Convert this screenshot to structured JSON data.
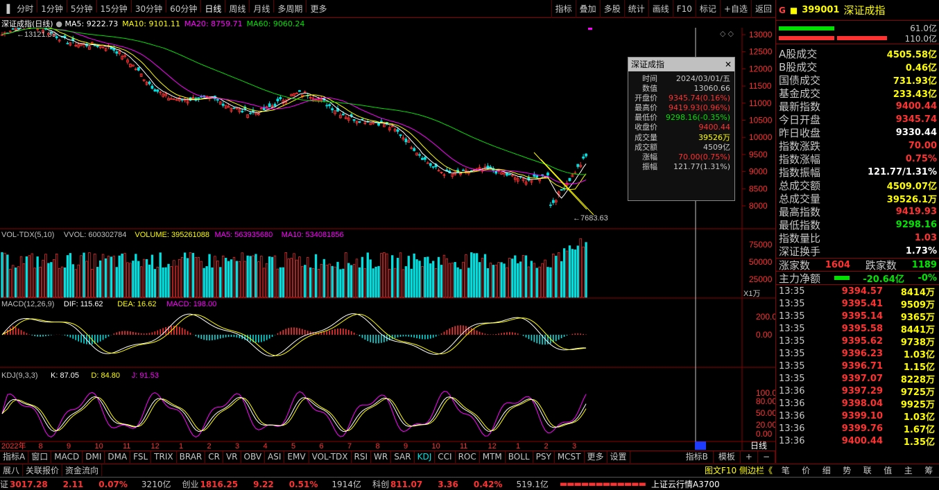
{
  "toolbar": {
    "periods": [
      "分时",
      "1分钟",
      "5分钟",
      "15分钟",
      "30分钟",
      "60分钟",
      "日线",
      "周线",
      "月线",
      "多周期",
      "更多"
    ],
    "active": "日线",
    "right": [
      "指标",
      "叠加",
      "多股",
      "统计",
      "画线",
      "F10",
      "标记",
      "+自选",
      "返回"
    ]
  },
  "chart": {
    "title": "深证成指(日线)",
    "ma": [
      {
        "t": "MA5: 9222.73",
        "c": "#ffffff"
      },
      {
        "t": "MA10: 9101.11",
        "c": "#ffff00"
      },
      {
        "t": "MA20: 8759.71",
        "c": "#ff00ff"
      },
      {
        "t": "MA60: 9060.24",
        "c": "#00e000"
      }
    ],
    "high_label": "13121.39",
    "low_label": "7683.63",
    "y_ticks": [
      "13000",
      "12500",
      "12000",
      "11500",
      "11000",
      "10500",
      "10000",
      "9500",
      "9000",
      "8500",
      "8000"
    ],
    "vol_legend": [
      {
        "t": "VOL-TDX(5,10)",
        "c": "#c0c0c0"
      },
      {
        "t": "VVOL: 600302784",
        "c": "#c0c0c0"
      },
      {
        "t": "VOLUME: 395261088",
        "c": "#ffff00"
      },
      {
        "t": "MA5: 563935680",
        "c": "#ff00ff"
      },
      {
        "t": "MA10: 534081856",
        "c": "#ff00ff"
      }
    ],
    "vol_ticks": [
      "75000",
      "50000",
      "25000"
    ],
    "vol_unit": "X1万",
    "macd_legend": [
      {
        "t": "MACD(12,26,9)",
        "c": "#c0c0c0"
      },
      {
        "t": "DIF: 115.62",
        "c": "#ffffff"
      },
      {
        "t": "DEA: 16.62",
        "c": "#ffff00"
      },
      {
        "t": "MACD: 198.00",
        "c": "#ff00ff"
      }
    ],
    "macd_ticks": [
      "200.0",
      "0.00"
    ],
    "kdj_legend": [
      {
        "t": "KDJ(9,3,3)",
        "c": "#c0c0c0"
      },
      {
        "t": "K: 87.05",
        "c": "#ffffff"
      },
      {
        "t": "D: 84.80",
        "c": "#ffff00"
      },
      {
        "t": "J: 91.53",
        "c": "#ff00ff"
      }
    ],
    "kdj_ticks": [
      "100.00",
      "80.00",
      "50.00",
      "20.00",
      "0.00"
    ],
    "x_labels": [
      "2022年",
      "8",
      "9",
      "10",
      "11",
      "12",
      "1",
      "2",
      "3",
      "4",
      "5",
      "6",
      "7",
      "8",
      "9",
      "10",
      "11",
      "12",
      "1",
      "2",
      "3"
    ],
    "period_btn": "日线"
  },
  "tooltip": {
    "title": "深证成指",
    "rows": [
      {
        "k": "时间",
        "v": "2024/03/01/五",
        "c": "#c8c8c8"
      },
      {
        "k": "数值",
        "v": "13060.66",
        "c": "#c8c8c8"
      },
      {
        "k": "开盘价",
        "v": "9345.74(0.16%)",
        "c": "#ff3232"
      },
      {
        "k": "最高价",
        "v": "9419.93(0.96%)",
        "c": "#ff3232"
      },
      {
        "k": "最低价",
        "v": "9298.16(-0.35%)",
        "c": "#00e000"
      },
      {
        "k": "收盘价",
        "v": "9400.44",
        "c": "#ff3232"
      },
      {
        "k": "成交量",
        "v": "39526万",
        "c": "#ffff00"
      },
      {
        "k": "成交额",
        "v": "4509亿",
        "c": "#c8c8c8"
      },
      {
        "k": "涨幅",
        "v": "70.00(0.75%)",
        "c": "#ff3232"
      },
      {
        "k": "振幅",
        "v": "121.77(1.31%)",
        "c": "#c8c8c8"
      }
    ]
  },
  "panel": {
    "g": "G",
    "code": "399001",
    "name": "深证成指",
    "buy": "61.0亿",
    "sell": "110.0亿",
    "rows": [
      {
        "l": "A股成交",
        "v": "4505.58亿",
        "c": "#ffff00"
      },
      {
        "l": "B股成交",
        "v": "0.46亿",
        "c": "#ffff00"
      },
      {
        "l": "国债成交",
        "v": "731.93亿",
        "c": "#ffff00"
      },
      {
        "l": "基金成交",
        "v": "233.43亿",
        "c": "#ffff00"
      },
      {
        "l": "最新指数",
        "v": "9400.44",
        "c": "#ff3232"
      },
      {
        "l": "今日开盘",
        "v": "9345.74",
        "c": "#ff3232"
      },
      {
        "l": "昨日收盘",
        "v": "9330.44",
        "c": "#ffffff"
      },
      {
        "l": "指数涨跌",
        "v": "70.00",
        "c": "#ff3232"
      },
      {
        "l": "指数涨幅",
        "v": "0.75%",
        "c": "#ff3232"
      },
      {
        "l": "指数振幅",
        "v": "121.77/1.31%",
        "c": "#ffffff"
      },
      {
        "l": "总成交额",
        "v": "4509.07亿",
        "c": "#ffff00"
      },
      {
        "l": "总成交量",
        "v": "39526.1万",
        "c": "#ffff00"
      },
      {
        "l": "最高指数",
        "v": "9419.93",
        "c": "#ff3232"
      },
      {
        "l": "最低指数",
        "v": "9298.16",
        "c": "#00e600"
      },
      {
        "l": "指数量比",
        "v": "1.03",
        "c": "#ff3232"
      },
      {
        "l": "深证换手",
        "v": "1.73%",
        "c": "#ffffff"
      }
    ],
    "up_label": "涨家数",
    "up": "1604",
    "down_label": "跌家数",
    "down": "1189",
    "flow_label": "主力净额",
    "flow": "-20.64亿",
    "flow_pct": "-0%",
    "ticks": [
      {
        "t": "13:35",
        "p": "9394.57",
        "v": "8414万"
      },
      {
        "t": "13:35",
        "p": "9395.41",
        "v": "9509万"
      },
      {
        "t": "13:35",
        "p": "9395.14",
        "v": "9365万"
      },
      {
        "t": "13:35",
        "p": "9395.58",
        "v": "8441万"
      },
      {
        "t": "13:35",
        "p": "9395.62",
        "v": "9738万"
      },
      {
        "t": "13:35",
        "p": "9396.23",
        "v": "1.03亿"
      },
      {
        "t": "13:35",
        "p": "9396.71",
        "v": "1.15亿"
      },
      {
        "t": "13:35",
        "p": "9397.07",
        "v": "8228万"
      },
      {
        "t": "13:36",
        "p": "9397.29",
        "v": "9725万"
      },
      {
        "t": "13:36",
        "p": "9398.04",
        "v": "9925万"
      },
      {
        "t": "13:36",
        "p": "9399.10",
        "v": "1.03亿"
      },
      {
        "t": "13:36",
        "p": "9399.76",
        "v": "1.67亿"
      },
      {
        "t": "13:36",
        "p": "9400.44",
        "v": "1.35亿"
      }
    ]
  },
  "indicators": [
    "指标A",
    "窗口",
    "MACD",
    "DMI",
    "DMA",
    "FSL",
    "TRIX",
    "BRAR",
    "CR",
    "VR",
    "OBV",
    "ASI",
    "EMV",
    "VOL-TDX",
    "RSI",
    "WR",
    "SAR",
    "KDJ",
    "CCI",
    "ROC",
    "MTM",
    "BOLL",
    "PSY",
    "MCST",
    "更多",
    "设置"
  ],
  "ind_active": "KDJ",
  "ind_right": [
    "指标B",
    "模板",
    "+",
    "−"
  ],
  "tabs2": [
    "展八",
    "关联报价",
    "资金流向"
  ],
  "tabs2_right": "图文F10 侧边栏《",
  "ptabs": [
    "笔",
    "价",
    "细",
    "势",
    "联",
    "值",
    "主",
    "筹"
  ],
  "status": [
    {
      "n": "证",
      "v": "3017.28",
      "d": "2.11",
      "p": "0.07%",
      "a": "3210亿"
    },
    {
      "n": "创业",
      "v": "1816.25",
      "d": "9.22",
      "p": "0.51%",
      "a": "1914亿"
    },
    {
      "n": "科创",
      "v": "811.07",
      "d": "3.36",
      "p": "0.42%",
      "a": "519.1亿"
    }
  ],
  "status_right": "上证云行情A3700"
}
